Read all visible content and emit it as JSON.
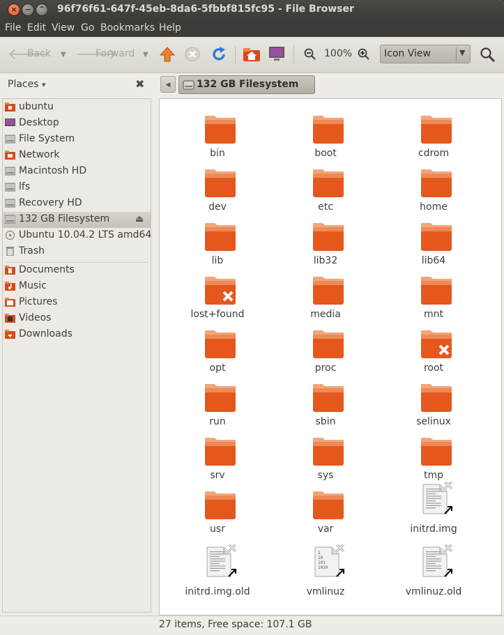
{
  "window": {
    "title": "96f76f61-647f-45eb-8da6-5fbbf815fc95 - File Browser",
    "close_glyph": "×",
    "min_glyph": "−",
    "max_glyph": "⌃"
  },
  "menu": [
    "File",
    "Edit",
    "View",
    "Go",
    "Bookmarks",
    "Help"
  ],
  "toolbar": {
    "back_label": "Back",
    "forward_label": "Forward",
    "zoom_level": "100%",
    "view_mode": "Icon View"
  },
  "sidebar": {
    "header": "Places",
    "header_caret": "▾",
    "close_glyph": "✖",
    "items": [
      {
        "label": "ubuntu",
        "icon": "home-folder-icon"
      },
      {
        "label": "Desktop",
        "icon": "desktop-icon"
      },
      {
        "label": "File System",
        "icon": "harddisk-icon"
      },
      {
        "label": "Network",
        "icon": "network-icon"
      },
      {
        "label": "Macintosh HD",
        "icon": "harddisk-icon"
      },
      {
        "label": "lfs",
        "icon": "harddisk-icon"
      },
      {
        "label": "Recovery HD",
        "icon": "harddisk-icon"
      },
      {
        "label": "132 GB Filesystem",
        "icon": "harddisk-icon",
        "selected": true
      },
      {
        "label": "Ubuntu 10.04.2 LTS amd64",
        "icon": "cdrom-icon"
      },
      {
        "label": "Trash",
        "icon": "trash-icon"
      }
    ],
    "bookmarks": [
      {
        "label": "Documents",
        "icon": "documents-folder-icon"
      },
      {
        "label": "Music",
        "icon": "music-folder-icon"
      },
      {
        "label": "Pictures",
        "icon": "pictures-folder-icon"
      },
      {
        "label": "Videos",
        "icon": "videos-folder-icon"
      },
      {
        "label": "Downloads",
        "icon": "downloads-folder-icon"
      }
    ]
  },
  "pathbar": {
    "back_glyph": "◀",
    "current": "132 GB Filesystem"
  },
  "files": [
    {
      "name": "bin",
      "type": "folder"
    },
    {
      "name": "boot",
      "type": "folder"
    },
    {
      "name": "cdrom",
      "type": "folder"
    },
    {
      "name": "dev",
      "type": "folder"
    },
    {
      "name": "etc",
      "type": "folder"
    },
    {
      "name": "home",
      "type": "folder"
    },
    {
      "name": "lib",
      "type": "folder"
    },
    {
      "name": "lib32",
      "type": "folder"
    },
    {
      "name": "lib64",
      "type": "folder"
    },
    {
      "name": "lost+found",
      "type": "folder-noaccess"
    },
    {
      "name": "media",
      "type": "folder"
    },
    {
      "name": "mnt",
      "type": "folder"
    },
    {
      "name": "opt",
      "type": "folder"
    },
    {
      "name": "proc",
      "type": "folder"
    },
    {
      "name": "root",
      "type": "folder-noaccess"
    },
    {
      "name": "run",
      "type": "folder"
    },
    {
      "name": "sbin",
      "type": "folder"
    },
    {
      "name": "selinux",
      "type": "folder"
    },
    {
      "name": "srv",
      "type": "folder"
    },
    {
      "name": "sys",
      "type": "folder"
    },
    {
      "name": "tmp",
      "type": "folder"
    },
    {
      "name": "usr",
      "type": "folder"
    },
    {
      "name": "var",
      "type": "folder"
    },
    {
      "name": "initrd.img",
      "type": "text-link-broken"
    },
    {
      "name": "initrd.img.old",
      "type": "text-link-broken"
    },
    {
      "name": "vmlinuz",
      "type": "binary-link-broken"
    },
    {
      "name": "vmlinuz.old",
      "type": "text-link-broken"
    }
  ],
  "status": "27 items, Free space: 107.1 GB",
  "colors": {
    "folder_top": "#f2a57a",
    "folder_body": "#e4581d",
    "chrome_dark": "#3c3b37"
  }
}
